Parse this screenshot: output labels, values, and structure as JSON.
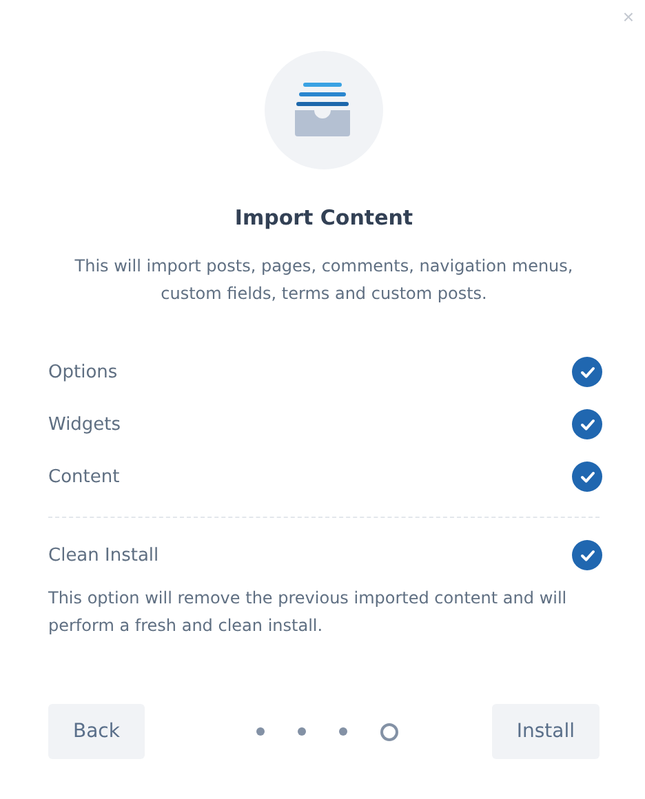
{
  "close": "×",
  "title": "Import Content",
  "description": "This will import posts, pages, comments, navigation menus, custom fields, terms and custom posts.",
  "items": [
    {
      "label": "Options",
      "checked": true
    },
    {
      "label": "Widgets",
      "checked": true
    },
    {
      "label": "Content",
      "checked": true
    }
  ],
  "clean_install": {
    "label": "Clean Install",
    "checked": true,
    "description": "This option will remove the previous imported content and will perform a fresh and clean install."
  },
  "steps": [
    {
      "selected": false
    },
    {
      "selected": false
    },
    {
      "selected": false
    },
    {
      "selected": true
    }
  ],
  "buttons": {
    "back": "Back",
    "install": "Install"
  }
}
